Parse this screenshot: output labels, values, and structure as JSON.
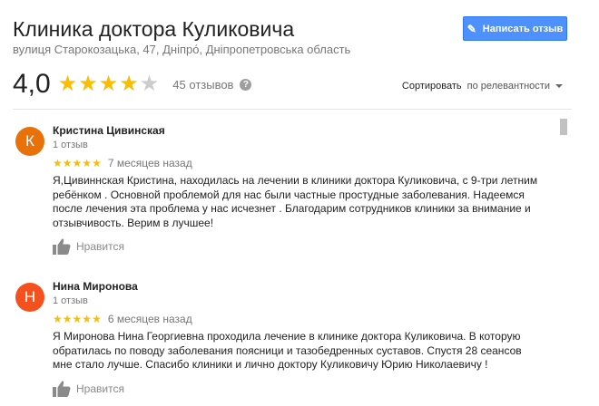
{
  "header": {
    "title": "Клиника доктора Куликовича",
    "address": "вулиця Старокозацька, 47, Дніпро́, Дніпропетровська область",
    "write_review_label": "Написать отзыв"
  },
  "summary": {
    "rating": "4,0",
    "rating_value": 4,
    "max_rating": 5,
    "review_count": "45 отзывов"
  },
  "sort": {
    "label": "Сортировать",
    "value": "по релевантности"
  },
  "reviews": [
    {
      "initial": "К",
      "avatar_color": "#e8710a",
      "author": "Кристина Цивинская",
      "author_reviews": "1 отзыв",
      "stars": 5,
      "date": "7 месяцев назад",
      "text": "Я,Цивиннская Кристина, находилась на лечении в клиники доктора Куликовича, с 9-три летним ребёнком . Основной проблемой для нас были частные простудные заболевания. Надеемся после лечения эта проблема у нас исчезнет . Благодарим сотрудников клиники за внимание и отзывчивость. Верим в лучшее!",
      "like_label": "Нравится"
    },
    {
      "initial": "Н",
      "avatar_color": "#f4511e",
      "author": "Нина Миронова",
      "author_reviews": "1 отзыв",
      "stars": 5,
      "date": "6 месяцев назад",
      "text": "Я Миронова Нина Георгиевна проходила лечение в клинике доктора Куликовича. В которую обратилась по поводу заболевания поясници и тазобедренных суставов. Спустя 28 сеансов мне стало лучше. Спасибо клиники и лично доктору Куликовичу Юрию Николаевичу !",
      "like_label": "Нравится"
    }
  ],
  "colors": {
    "star": "#fbbc04",
    "button": "#4d90fe"
  }
}
